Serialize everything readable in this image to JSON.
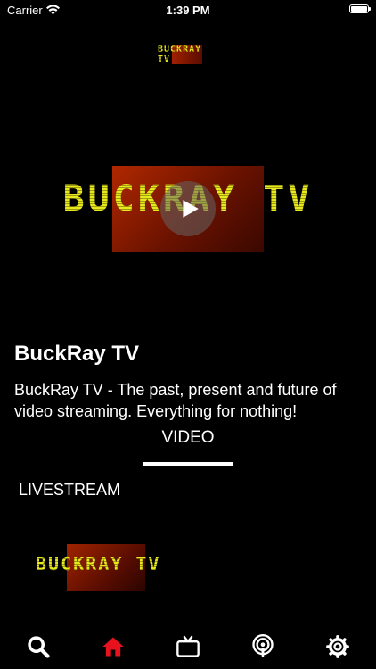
{
  "status_bar": {
    "carrier": "Carrier",
    "time": "1:39 PM"
  },
  "header": {
    "logo_text": "BUCKRAY TV"
  },
  "hero": {
    "logo_text": "BUCKRAY TV"
  },
  "channel": {
    "title": "BuckRay TV",
    "description": "BuckRay TV - The past, present and future of video streaming. Everything for nothing!"
  },
  "tabs": {
    "video_label": "VIDEO"
  },
  "livestream": {
    "label": "LIVESTREAM",
    "thumb_logo_text": "BUCKRAY TV"
  },
  "tab_bar": {
    "items": [
      {
        "icon": "search-icon"
      },
      {
        "icon": "home-icon",
        "active": true
      },
      {
        "icon": "tv-icon"
      },
      {
        "icon": "podcast-icon"
      },
      {
        "icon": "gear-icon"
      }
    ]
  },
  "colors": {
    "accent": "#e8121e",
    "logo_yellow": "#e4e41c",
    "background": "#000000"
  }
}
